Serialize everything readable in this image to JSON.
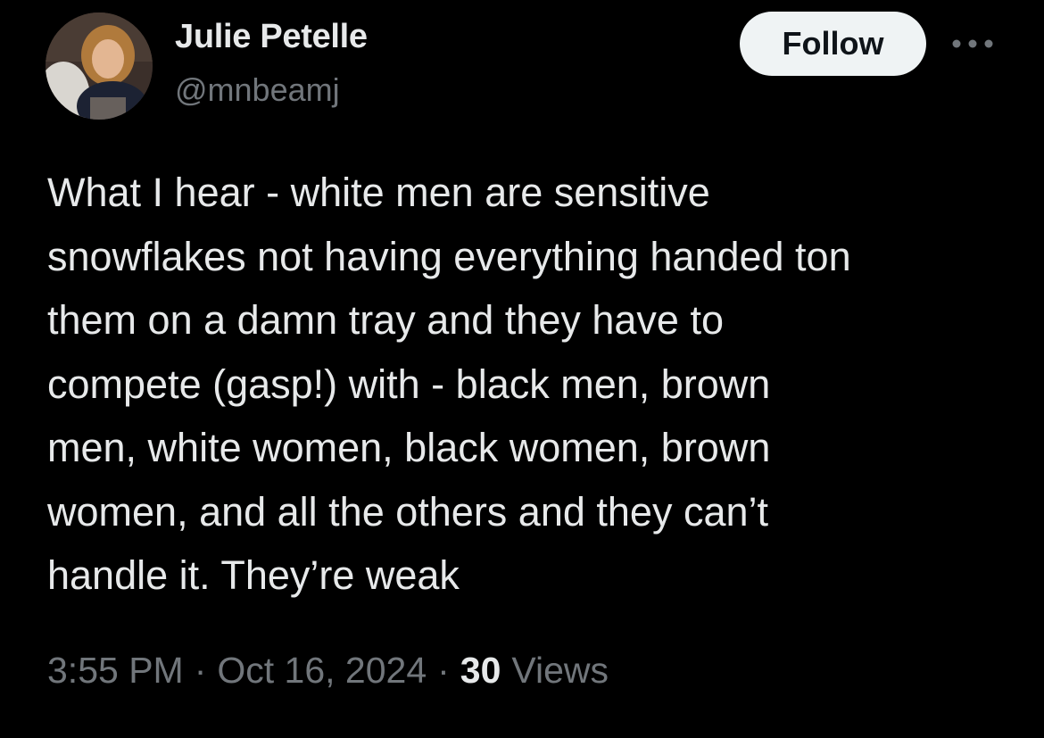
{
  "author": {
    "name": "Julie Petelle",
    "handle": "@mnbeamj",
    "avatar_icon": "profile-photo"
  },
  "actions": {
    "follow_label": "Follow",
    "more_icon": "ellipsis-icon"
  },
  "tweet": {
    "text": "What I hear - white men are sensitive\nsnowflakes not having everything handed ton\nthem on a damn tray and they have to\ncompete (gasp!) with - black men, brown\nmen, white women, black women, brown\nwomen, and all the others and they can’t\nhandle it. They’re weak",
    "time": "3:55 PM",
    "date": "Oct 16, 2024",
    "separator": "·",
    "views_count": "30",
    "views_label": "Views"
  },
  "colors": {
    "background": "#000000",
    "primary_text": "#e7e9ea",
    "secondary_text": "#71767b",
    "follow_bg": "#eff3f4",
    "follow_text": "#0f1419"
  }
}
